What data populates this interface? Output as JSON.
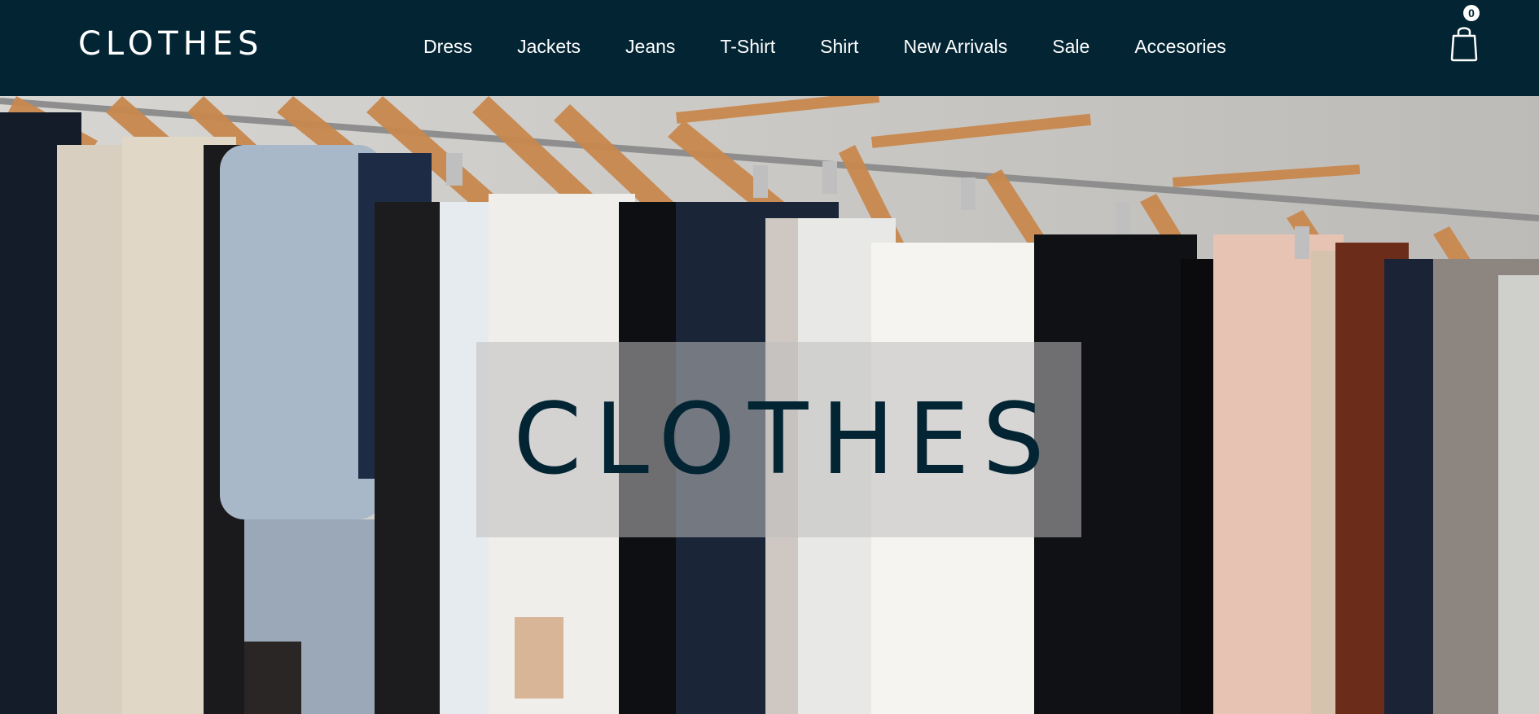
{
  "brand": {
    "logo_text": "CLOTHES"
  },
  "nav": {
    "items": [
      {
        "label": "Dress"
      },
      {
        "label": "Jackets"
      },
      {
        "label": "Jeans"
      },
      {
        "label": "T-Shirt"
      },
      {
        "label": "Shirt"
      },
      {
        "label": "New Arrivals"
      },
      {
        "label": "Sale"
      },
      {
        "label": "Accesories"
      }
    ]
  },
  "cart": {
    "icon": "shopping-bag-icon",
    "count": "0"
  },
  "hero": {
    "title": "CLOTHES",
    "image": "clothing-rack-photo",
    "overlay_color": "#bebebe"
  },
  "colors": {
    "navbar_bg": "#022433",
    "nav_text": "#ffffff",
    "hero_title": "#022433"
  }
}
